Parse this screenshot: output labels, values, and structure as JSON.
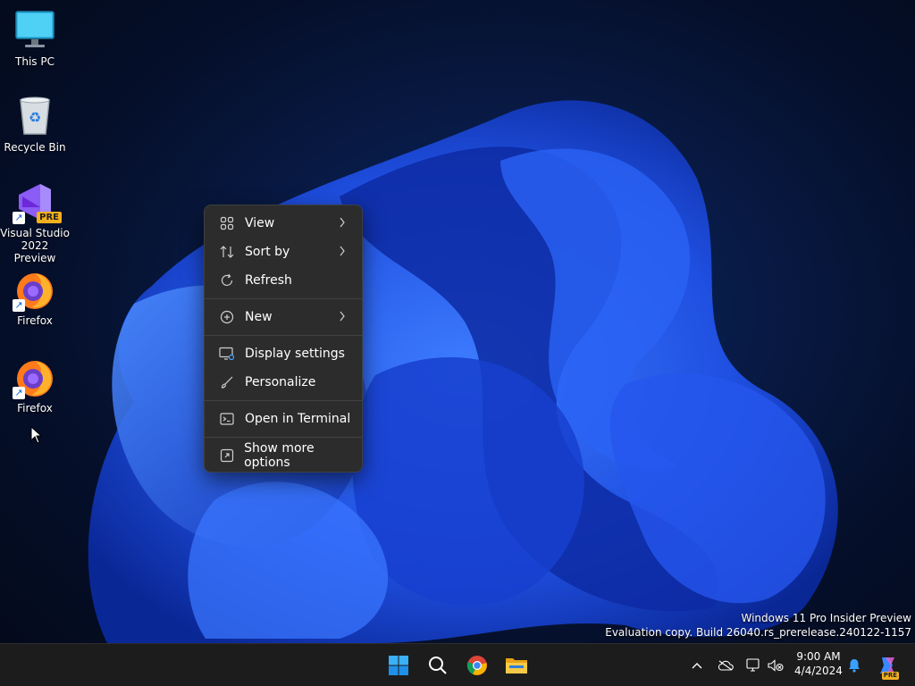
{
  "desktop": {
    "icons": [
      {
        "label": "This PC",
        "icon": "monitor-icon"
      },
      {
        "label": "Recycle Bin",
        "icon": "recycle-bin-icon"
      },
      {
        "label": "Visual Studio 2022 Preview",
        "icon": "visual-studio-icon",
        "badge": "PRE"
      },
      {
        "label": "Firefox",
        "icon": "firefox-icon"
      },
      {
        "label": "Firefox",
        "icon": "firefox-icon"
      }
    ]
  },
  "context_menu": {
    "items": [
      {
        "label": "View",
        "icon": "grid-view-icon",
        "submenu": true
      },
      {
        "label": "Sort by",
        "icon": "sort-icon",
        "submenu": true
      },
      {
        "label": "Refresh",
        "icon": "refresh-icon",
        "submenu": false
      },
      {
        "label": "New",
        "icon": "plus-circle-icon",
        "submenu": true
      },
      {
        "label": "Display settings",
        "icon": "display-settings-icon",
        "submenu": false
      },
      {
        "label": "Personalize",
        "icon": "brush-icon",
        "submenu": false
      },
      {
        "label": "Open in Terminal",
        "icon": "terminal-icon",
        "submenu": false
      },
      {
        "label": "Show more options",
        "icon": "more-options-icon",
        "submenu": false
      }
    ]
  },
  "watermark": {
    "line1": "Windows 11 Pro Insider Preview",
    "line2": "Evaluation copy. Build 26040.rs_prerelease.240122-1157"
  },
  "taskbar": {
    "apps": [
      "start-icon",
      "search-icon",
      "chrome-icon",
      "file-explorer-icon"
    ],
    "tray": [
      "chevron-up-icon",
      "onedrive-icon",
      "network-icon",
      "volume-muted-icon"
    ],
    "copilot_badge": "PRE"
  },
  "clock": {
    "time": "9:00 AM",
    "date": "4/4/2024"
  },
  "colors": {
    "menu_bg": "#2c2c2c",
    "taskbar_bg": "#1c1c1c",
    "accent": "#1a73e8"
  }
}
